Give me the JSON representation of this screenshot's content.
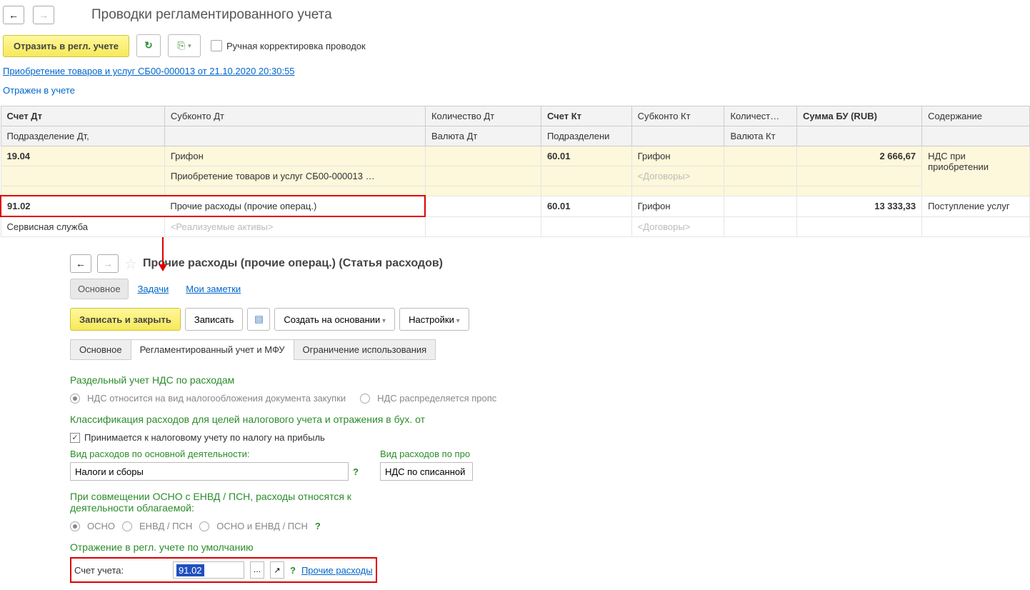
{
  "header": {
    "title": "Проводки регламентированного учета"
  },
  "toolbar": {
    "reflect_label": "Отразить в регл. учете",
    "manual_label": "Ручная корректировка проводок"
  },
  "doc_link": "Приобретение товаров и услуг СБ00-000013 от 21.10.2020 20:30:55",
  "status": "Отражен в учете",
  "table": {
    "headers": {
      "dt_account": "Счет Дт",
      "dt_sub": "Субконто Дт",
      "dt_qty": "Количество Дт",
      "kt_account": "Счет Кт",
      "kt_sub": "Субконто Кт",
      "kt_qty": "Количест…",
      "sum": "Сумма БУ (RUB)",
      "descr": "Содержание",
      "dt_dept": "Подразделение Дт,",
      "dt_curr": "Валюта Дт",
      "kt_dept": "Подразделени",
      "kt_curr": "Валюта Кт"
    },
    "row1": {
      "dt_account": "19.04",
      "dt_sub1": "Грифон",
      "dt_sub2": "Приобретение товаров и услуг СБ00-000013 …",
      "kt_account": "60.01",
      "kt_sub1": "Грифон",
      "kt_sub2": "<Договоры>",
      "sum": "2 666,67",
      "descr": "НДС при приобретении"
    },
    "row2": {
      "dt_account": "91.02",
      "dt_sub1": "Прочие расходы (прочие операц.)",
      "dt_sub2": "<Реализуемые активы>",
      "dt_dept": "Сервисная служба",
      "kt_account": "60.01",
      "kt_sub1": "Грифон",
      "kt_sub2": "<Договоры>",
      "sum": "13 333,33",
      "descr": "Поступление услуг"
    }
  },
  "detail": {
    "title": "Прочие расходы (прочие операц.) (Статья расходов)",
    "tabs": {
      "main": "Основное",
      "tasks": "Задачи",
      "notes": "Мои заметки"
    },
    "buttons": {
      "save_close": "Записать и закрыть",
      "save": "Записать",
      "create": "Создать на основании",
      "settings": "Настройки"
    },
    "subtabs": {
      "main": "Основное",
      "regl": "Регламентированный учет и МФУ",
      "restrict": "Ограничение использования"
    },
    "sect1": {
      "title": "Раздельный учет НДС по расходам",
      "opt1": "НДС относится на вид налогообложения документа закупки",
      "opt2": "НДС распределяется пропс"
    },
    "sect2": {
      "title": "Классификация расходов для целей налогового учета и отражения в бух. от",
      "check": "Принимается к налоговому учету по налогу на прибыль",
      "label1": "Вид расходов по основной деятельности:",
      "val1": "Налоги и сборы",
      "label2": "Вид расходов по про",
      "val2": "НДС по списанной кр"
    },
    "sect3": {
      "title": "При совмещении ОСНО с ЕНВД / ПСН, расходы относятся к деятельности облагаемой:",
      "opt1": "ОСНО",
      "opt2": "ЕНВД / ПСН",
      "opt3": "ОСНО и ЕНВД / ПСН"
    },
    "sect4": {
      "title": "Отражение в регл. учете по умолчанию",
      "label": "Счет учета:",
      "value": "91.02",
      "link": "Прочие расходы"
    }
  }
}
